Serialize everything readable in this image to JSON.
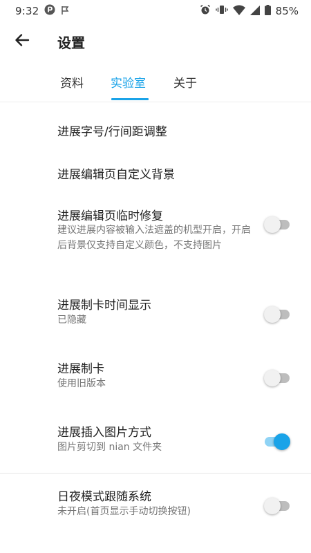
{
  "status_bar": {
    "time": "9:32",
    "battery": "85%",
    "icons": [
      "app-notification-icon",
      "flag-icon",
      "alarm-icon",
      "vibrate-icon",
      "wifi-icon",
      "signal-icon",
      "battery-icon"
    ]
  },
  "header": {
    "title": "设置"
  },
  "tabs": [
    {
      "label": "资料",
      "active": false
    },
    {
      "label": "实验室",
      "active": true
    },
    {
      "label": "关于",
      "active": false
    }
  ],
  "accent_color": "#1aa3e8",
  "items": [
    {
      "title": "进展字号/行间距调整"
    },
    {
      "title": "进展编辑页自定义背景"
    },
    {
      "title": "进展编辑页临时修复",
      "subtitle": "建议进展内容被输入法遮盖的机型开启，开启后背景仅支持自定义颜色，不支持图片",
      "toggle": false
    },
    {
      "title": "进展制卡时间显示",
      "subtitle": "已隐藏",
      "toggle": false
    },
    {
      "title": "进展制卡",
      "subtitle": "使用旧版本",
      "toggle": false
    },
    {
      "title": "进展插入图片方式",
      "subtitle": "图片剪切到 nian 文件夹",
      "toggle": true
    },
    {
      "title": "日夜模式跟随系统",
      "subtitle": "未开启(首页显示手动切换按钮)",
      "toggle": false
    }
  ]
}
